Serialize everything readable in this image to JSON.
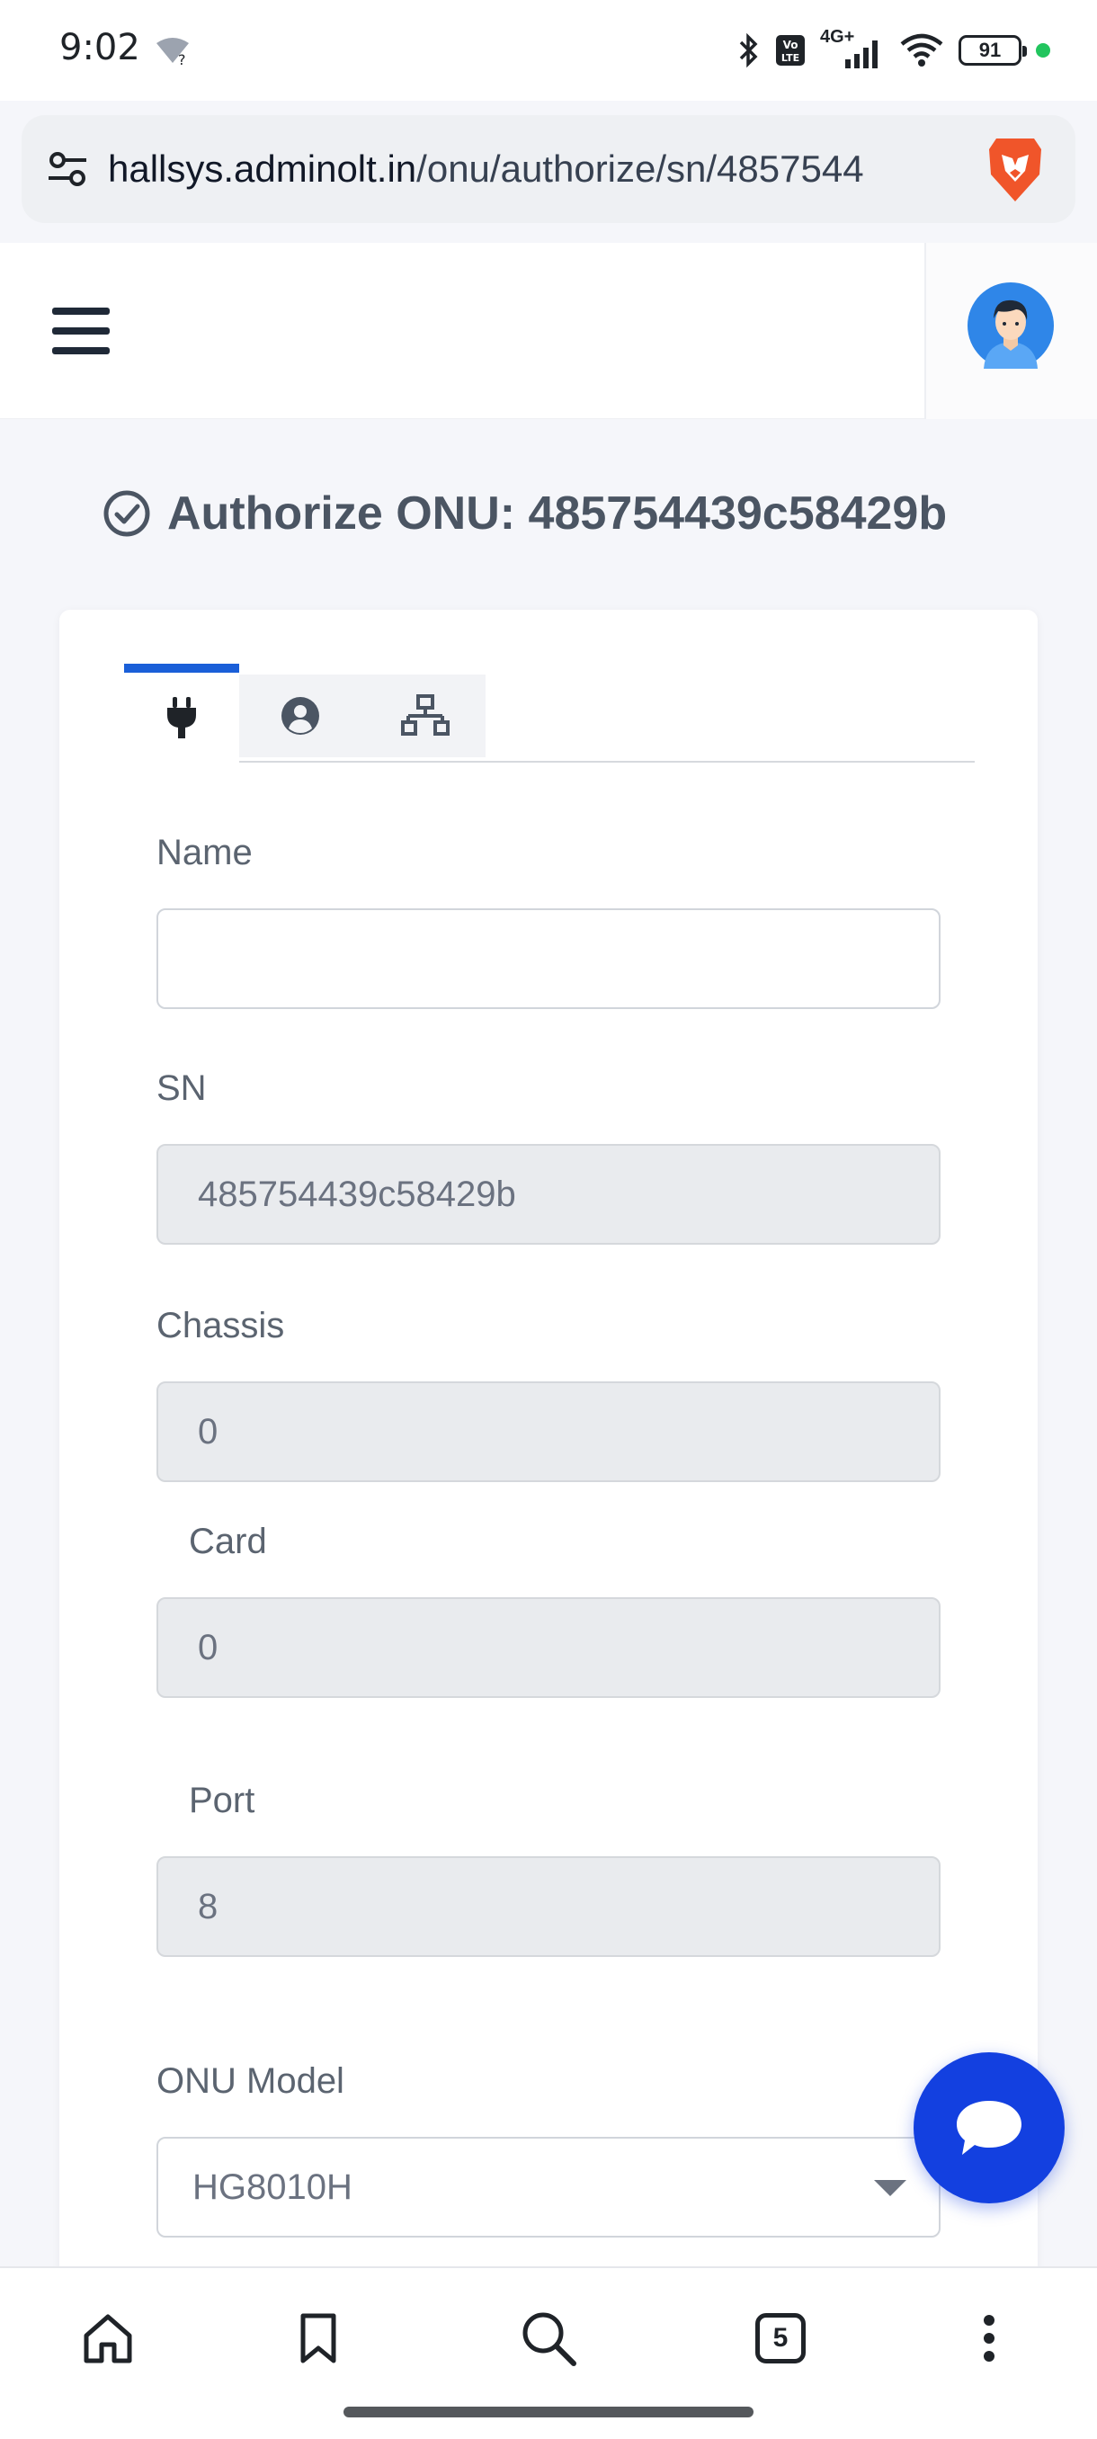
{
  "status_bar": {
    "time": "9:02",
    "battery": "91",
    "network": "4G+",
    "icons": [
      "wifi-question-icon",
      "bluetooth-icon",
      "volte-icon",
      "signal-icon",
      "wifi-icon",
      "battery-icon"
    ]
  },
  "browser": {
    "url_host": "hallsys.adminolt.in",
    "url_path": "/onu/authorize/sn/4857544",
    "tab_count": "5"
  },
  "page": {
    "title": "Authorize ONU: 485754439c58429b"
  },
  "tabs": [
    {
      "icon": "plug-icon",
      "active": true
    },
    {
      "icon": "user-circle-icon",
      "active": false
    },
    {
      "icon": "network-icon",
      "active": false
    }
  ],
  "form": {
    "name": {
      "label": "Name",
      "value": ""
    },
    "sn": {
      "label": "SN",
      "value": "485754439c58429b"
    },
    "chassis": {
      "label": "Chassis",
      "value": "0"
    },
    "card": {
      "label": "Card",
      "value": "0"
    },
    "port": {
      "label": "Port",
      "value": "8"
    },
    "onu_model": {
      "label": "ONU Model",
      "value": "HG8010H"
    }
  },
  "colors": {
    "accent_blue": "#1a5fd8",
    "chat_fab": "#1340e0",
    "brave_orange": "#f0552a"
  }
}
